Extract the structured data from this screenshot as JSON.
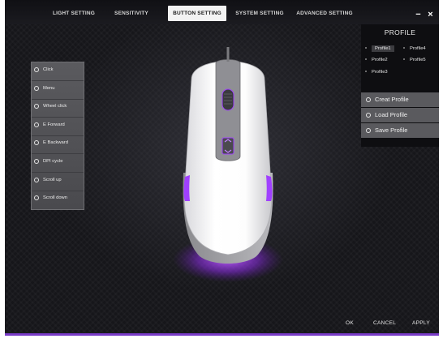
{
  "tabs": [
    {
      "label": "LIGHT SETTING",
      "active": false
    },
    {
      "label": "SENSITIVITY",
      "active": false
    },
    {
      "label": "BUTTON SETTING",
      "active": true
    },
    {
      "label": "SYSTEM SETTING",
      "active": false
    },
    {
      "label": "ADVANCED SETTING",
      "active": false
    }
  ],
  "window_controls": {
    "minimize": "−",
    "close": "×"
  },
  "button_list": [
    {
      "label": "Click"
    },
    {
      "label": "Menu"
    },
    {
      "label": "Wheel click"
    },
    {
      "label": "E Forward"
    },
    {
      "label": "E Backward"
    },
    {
      "label": "DPI cycle"
    },
    {
      "label": "Scroll up"
    },
    {
      "label": "Scroll down"
    }
  ],
  "profile": {
    "title": "PROFILE",
    "profiles": [
      {
        "label": "Profile1",
        "selected": true
      },
      {
        "label": "Profile2",
        "selected": false
      },
      {
        "label": "Profile3",
        "selected": false
      },
      {
        "label": "Profile4",
        "selected": false
      },
      {
        "label": "Profile5",
        "selected": false
      }
    ],
    "actions": [
      {
        "label": "Creat Profile"
      },
      {
        "label": "Load Profile"
      },
      {
        "label": "Save Profile"
      }
    ]
  },
  "footer": {
    "ok": "OK",
    "cancel": "CANCEL",
    "apply": "APPLY"
  },
  "colors": {
    "accent": "#a040ff",
    "background": "#16161a",
    "tab_active": "#f3f3f3",
    "panel": "#5a5a5e"
  }
}
